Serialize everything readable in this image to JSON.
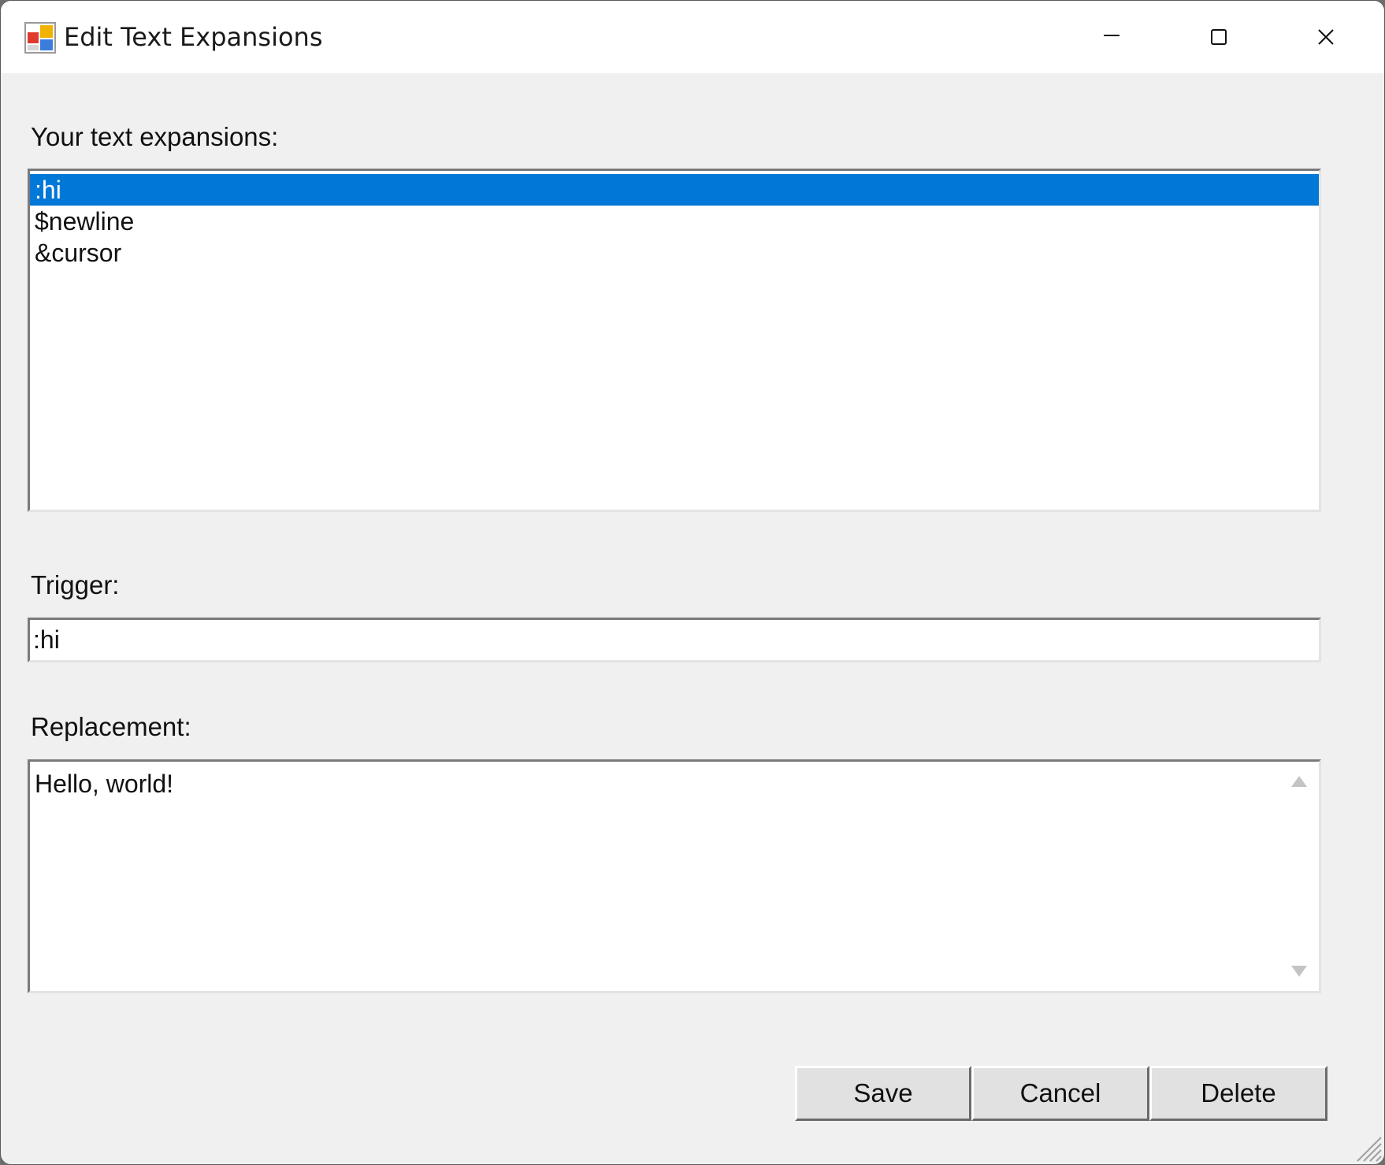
{
  "window": {
    "title": "Edit Text Expansions",
    "icon": "app-forms-icon"
  },
  "caption_buttons": {
    "minimize_icon": "minimize-icon",
    "maximize_icon": "maximize-icon",
    "close_icon": "close-icon"
  },
  "expansions": {
    "label": "Your text expansions:",
    "items": [
      {
        "text": ":hi",
        "selected": true
      },
      {
        "text": "$newline",
        "selected": false
      },
      {
        "text": "&cursor",
        "selected": false
      }
    ]
  },
  "trigger": {
    "label": "Trigger:",
    "value": ":hi"
  },
  "replacement": {
    "label": "Replacement:",
    "value": "Hello, world!"
  },
  "buttons": {
    "save": "Save",
    "cancel": "Cancel",
    "delete": "Delete"
  },
  "colors": {
    "selection": "#0078d7",
    "dialog_background": "#f0f0f0",
    "titlebar_background": "#ffffff"
  }
}
